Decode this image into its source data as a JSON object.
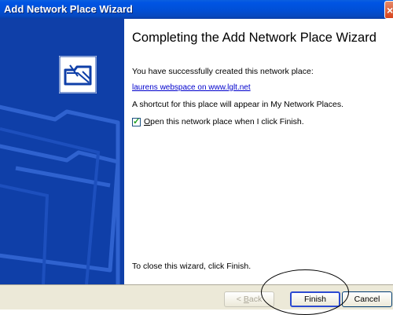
{
  "window": {
    "title": "Add Network Place Wizard",
    "close_glyph": "×"
  },
  "content": {
    "heading": "Completing the Add Network Place Wizard",
    "line1": "You have successfully created this network place:",
    "place_link": "laurens webspace on www.lglt.net",
    "line3": "A shortcut for this place will appear in My Network Places.",
    "checkbox": {
      "mnemonic": "O",
      "label_rest": "pen this network place when I click Finish.",
      "checked": true
    },
    "line5": "To close this wizard, click Finish."
  },
  "buttons": {
    "back": {
      "prefix": "< ",
      "mnemonic": "B",
      "rest": "ack",
      "enabled": false
    },
    "finish": "Finish",
    "cancel": "Cancel"
  },
  "colors": {
    "titlebar": "#0054e3",
    "left_panel": "#0f3fa8",
    "footer": "#ece9d8",
    "link": "#0000cc"
  },
  "icons": {
    "wizard": "network-folder-icon",
    "close": "close-icon",
    "checkbox_mark": "checkmark-icon"
  }
}
